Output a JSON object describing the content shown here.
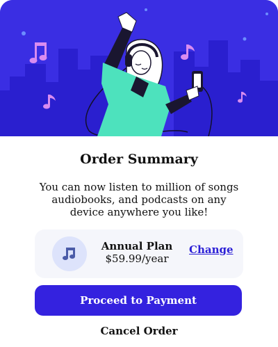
{
  "colors": {
    "hero_background": "#3a2ee3",
    "skyline": "#2a1fcf",
    "accent": "#3422df",
    "music_note": "#d98cf0",
    "plan_background": "#f5f6fb",
    "plan_icon_background": "#dde3fb",
    "link": "#2c20d6"
  },
  "hero": {
    "illustration": "woman-listening-to-music-with-headphones",
    "icons": [
      "music-note-icon",
      "music-note-icon",
      "music-note-icon",
      "music-note-icon"
    ]
  },
  "summary": {
    "title": "Order Summary",
    "description": "You can now listen to million of songs audiobooks, and podcasts on any device anywhere you like!"
  },
  "plan": {
    "icon": "music-note-icon",
    "name": "Annual Plan",
    "price": "$59.99/year",
    "change_label": "Change"
  },
  "actions": {
    "proceed_label": "Proceed to Payment",
    "cancel_label": "Cancel Order"
  }
}
